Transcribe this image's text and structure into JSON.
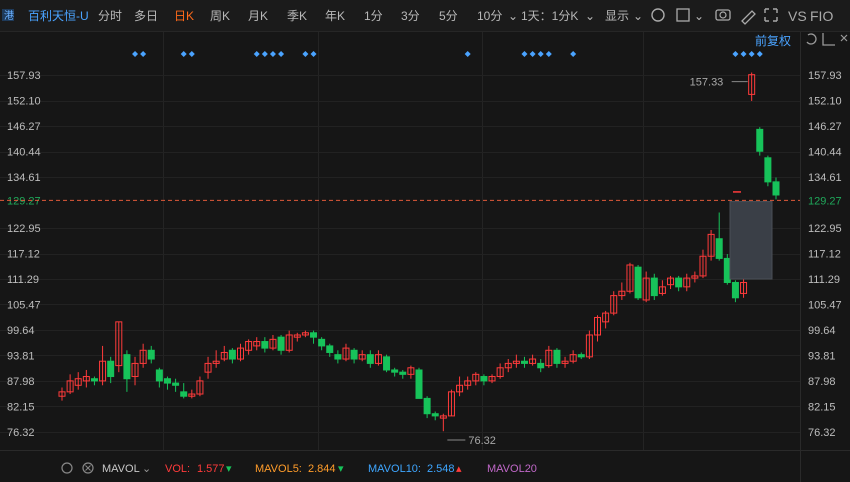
{
  "toolbar": {
    "title": "百利天恒-U",
    "tabs": [
      "分时",
      "多日",
      "日K",
      "周K",
      "月K",
      "季K",
      "年K",
      "1分",
      "3分",
      "5分",
      "10分"
    ],
    "active_tab": "日K",
    "period_select": "1天：1分K",
    "display_label": "显示",
    "right_labels": [
      "VS",
      "FIO"
    ],
    "adjust_label": "前复权"
  },
  "colors": {
    "up": "#ff3b3b",
    "down": "#17c35a",
    "marker": "#4aa3ff",
    "price_line": "#e05a3a",
    "price_box": "#1fa85a",
    "mavol5": "#ff9c2a",
    "mavol10": "#3ea6ff",
    "mavol20": "#c068c8"
  },
  "chart_data": {
    "type": "candlestick",
    "ylim": [
      73.5,
      162.5
    ],
    "y_ticks": [
      "157.93",
      "152.10",
      "146.27",
      "140.44",
      "134.61",
      "129.27",
      "122.95",
      "117.12",
      "111.29",
      "105.47",
      "99.64",
      "93.81",
      "87.98",
      "82.15",
      "76.32"
    ],
    "last_price": "129.27",
    "last_price_value": 129.27,
    "max_label": "157.33",
    "max_value": 157.33,
    "min_label": "76.32",
    "min_value": 76.32,
    "candles": [
      [
        84.5,
        85.5,
        86.5,
        83.5
      ],
      [
        85.5,
        88,
        89.5,
        85
      ],
      [
        87,
        88.5,
        90,
        86
      ],
      [
        88,
        89,
        90.5,
        86.5
      ],
      [
        88.5,
        88,
        89,
        87
      ],
      [
        88,
        92.5,
        96,
        87
      ],
      [
        92.5,
        89,
        93.5,
        87.5
      ],
      [
        91.5,
        101.5,
        101.5,
        90
      ],
      [
        94,
        88.5,
        95,
        85.5
      ],
      [
        89,
        92,
        93.5,
        87
      ],
      [
        92,
        95,
        96.5,
        91
      ],
      [
        95,
        93,
        96,
        92
      ],
      [
        90.5,
        88,
        91,
        86.5
      ],
      [
        88.5,
        87.5,
        89,
        86
      ],
      [
        87.5,
        87,
        88.5,
        85.5
      ],
      [
        85.5,
        84.5,
        87.5,
        84
      ],
      [
        84.5,
        85,
        86,
        84
      ],
      [
        85,
        88,
        89,
        84.5
      ],
      [
        90,
        92,
        93.5,
        88.5
      ],
      [
        92,
        92.5,
        95,
        91
      ],
      [
        93,
        94.5,
        96,
        92.5
      ],
      [
        95,
        93,
        95.5,
        92
      ],
      [
        93,
        95.5,
        96.5,
        92.5
      ],
      [
        95,
        97,
        97.5,
        94
      ],
      [
        96,
        97,
        98,
        95
      ],
      [
        97,
        95.5,
        98,
        94.5
      ],
      [
        95.5,
        97.5,
        98.5,
        95
      ],
      [
        98,
        95,
        98.5,
        94
      ],
      [
        95,
        98.5,
        99.5,
        94.5
      ],
      [
        98,
        98.5,
        99,
        97
      ],
      [
        98.5,
        99,
        99.5,
        98
      ],
      [
        99,
        98,
        99.5,
        96.5
      ],
      [
        97.5,
        96,
        98,
        95
      ],
      [
        96,
        94.5,
        96.5,
        93.5
      ],
      [
        94,
        93,
        95,
        92
      ],
      [
        93,
        95.5,
        96.5,
        92.5
      ],
      [
        95,
        93,
        95.5,
        92
      ],
      [
        93,
        94,
        95,
        92.5
      ],
      [
        94,
        92,
        95,
        91
      ],
      [
        92,
        94,
        95,
        91.5
      ],
      [
        93.5,
        90.5,
        94,
        90
      ],
      [
        90.5,
        90,
        91,
        89
      ],
      [
        90,
        89.5,
        90.5,
        88.5
      ],
      [
        89.5,
        91,
        91.5,
        88.5
      ],
      [
        90.5,
        84,
        91,
        84
      ],
      [
        84,
        80.5,
        84.5,
        79.5
      ],
      [
        80.5,
        80,
        81,
        79
      ],
      [
        79.5,
        80,
        80.5,
        76.5
      ],
      [
        80,
        85.5,
        86,
        80
      ],
      [
        85.5,
        87,
        89,
        84.5
      ],
      [
        87,
        88,
        89,
        86
      ],
      [
        88,
        89.5,
        90,
        87
      ],
      [
        89,
        88,
        89.5,
        87
      ],
      [
        88,
        89,
        89.5,
        87.5
      ],
      [
        89,
        91,
        92,
        88.5
      ],
      [
        91,
        92,
        93,
        90
      ],
      [
        92,
        92.5,
        94,
        91
      ],
      [
        92.5,
        92,
        93.5,
        91
      ],
      [
        92,
        93,
        94,
        91.5
      ],
      [
        92,
        91,
        93,
        90
      ],
      [
        91.5,
        95,
        96,
        91
      ],
      [
        95,
        92,
        95.5,
        91
      ],
      [
        92,
        92.5,
        93.5,
        91
      ],
      [
        92.5,
        94,
        95,
        92
      ],
      [
        94,
        93.5,
        94.5,
        93
      ],
      [
        93.5,
        98.5,
        99.5,
        93
      ],
      [
        98.5,
        102.5,
        103,
        97
      ],
      [
        101.5,
        103.5,
        104,
        100
      ],
      [
        103.5,
        107.5,
        108.5,
        103
      ],
      [
        107.5,
        108.5,
        110.5,
        106.5
      ],
      [
        108.5,
        114.5,
        115,
        108
      ],
      [
        114,
        107,
        114.5,
        106.5
      ],
      [
        106.5,
        111.5,
        113,
        106
      ],
      [
        111.5,
        107.5,
        112.5,
        106.5
      ],
      [
        108,
        109.5,
        111,
        107.5
      ],
      [
        110,
        111.5,
        112,
        109
      ],
      [
        111.5,
        109.5,
        112,
        108.5
      ],
      [
        109.5,
        111.5,
        112.5,
        108.5
      ],
      [
        111.5,
        112,
        113,
        110.5
      ],
      [
        112,
        116.5,
        118,
        111.5
      ],
      [
        116.5,
        121.5,
        122.5,
        115.5
      ],
      [
        120.5,
        116,
        126.5,
        115.5
      ],
      [
        116,
        110.5,
        117,
        110
      ],
      [
        110.5,
        107,
        111,
        106
      ],
      [
        108,
        110.5,
        111.5,
        107
      ],
      [
        153.5,
        158,
        158.5,
        152
      ],
      [
        145.5,
        140.5,
        146,
        139.5
      ],
      [
        139,
        133.5,
        139.5,
        132.5
      ],
      [
        133.5,
        130.5,
        134.5,
        129.5
      ]
    ],
    "hollow_box": [
      111.3,
      129.0
    ],
    "dash_mark": 131.2,
    "event_markers": [
      9,
      10,
      15,
      16,
      24,
      25,
      26,
      27,
      30,
      31,
      50,
      57,
      58,
      59,
      60,
      63,
      83,
      84,
      85,
      86
    ],
    "volume_legend": {
      "mavol_label": "MAVOL",
      "vol_label": "VOL:",
      "vol_value": "1.577",
      "mavol5_label": "MAVOL5:",
      "mavol5_value": "2.844",
      "mavol10_label": "MAVOL10:",
      "mavol10_value": "2.548",
      "mavol20_label": "MAVOL20"
    }
  }
}
